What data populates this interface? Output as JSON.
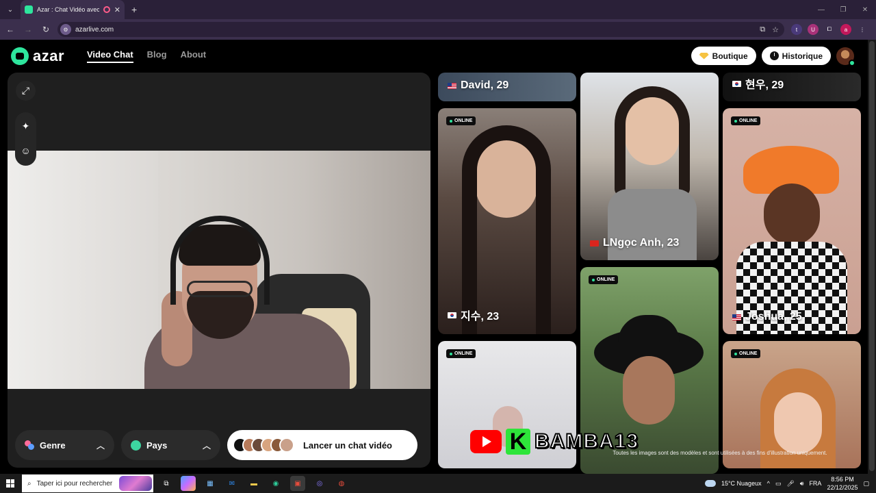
{
  "browser": {
    "tab_title": "Azar : Chat Vidéo avec de n",
    "url": "azarlive.com",
    "new_tab": "+",
    "close_tab": "✕"
  },
  "site": {
    "logo_text": "azar",
    "nav": [
      {
        "label": "Video Chat",
        "active": true
      },
      {
        "label": "Blog",
        "active": false
      },
      {
        "label": "About",
        "active": false
      }
    ],
    "boutique_label": "Boutique",
    "historique_label": "Historique"
  },
  "video_panel": {
    "genre_label": "Genre",
    "pays_label": "Pays",
    "start_label": "Lancer un chat vidéo"
  },
  "gallery": {
    "online_label": "ONLINE",
    "cards": [
      {
        "name": "David, 29",
        "flag": "us"
      },
      {
        "name": "현우, 29",
        "flag": "kr"
      },
      {
        "name": "LNgọc Anh, 23",
        "flag": "vn"
      },
      {
        "name": "지수, 23",
        "flag": "kr"
      },
      {
        "name": "Joshua, 25",
        "flag": "us"
      }
    ],
    "disclaimer": "Toutes les images sont des modèles et sont utilisées à des fins d'illustration uniquement.",
    "overlay_brand": "BAMBA13",
    "overlay_k": "K"
  },
  "taskbar": {
    "search_placeholder": "Taper ici pour rechercher",
    "weather": "15°C  Nuageux",
    "language": "FRA",
    "time": "8:56 PM",
    "date": "22/12/2025"
  },
  "colors": {
    "accent": "#2ee59d",
    "tab_bg": "#3b2f4d",
    "panel": "#1f1f1f"
  }
}
